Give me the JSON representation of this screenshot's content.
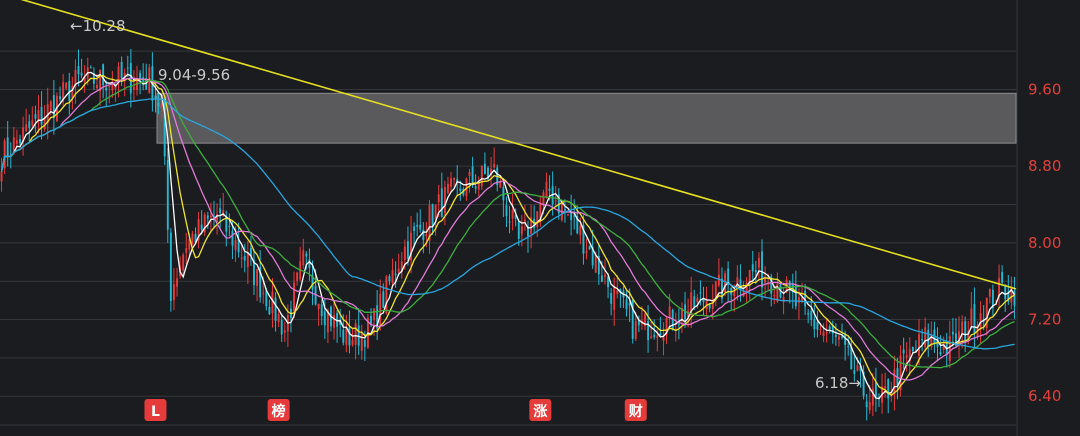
{
  "chart_data": {
    "type": "candlestick",
    "y_range": [
      6.1,
      10.45
    ],
    "y_ticks": [
      "9.60",
      "8.80",
      "8.00",
      "7.20",
      "6.40"
    ],
    "y_tick_values": [
      9.6,
      8.8,
      8.0,
      7.2,
      6.4
    ],
    "grid": true,
    "colors": {
      "background": "#1b1c20",
      "grid": "#34363b",
      "up": "#e63b3b",
      "down": "#27b7d1",
      "trendline": "#e5e021",
      "zone": "#5a5a5d",
      "axis_text": "#e0403a",
      "ma_white": "#ffffff",
      "ma_yellow": "#f2e52c",
      "ma_pink": "#e07ad6",
      "ma_green": "#3fae3f",
      "ma_blue": "#2aa6de"
    },
    "resistance_zone": {
      "low": 9.04,
      "high": 9.56
    },
    "trendline": {
      "start": [
        0,
        10.6
      ],
      "end": [
        330,
        7.52
      ]
    },
    "candles": {
      "count": 330,
      "key_closes": [
        [
          0,
          8.9
        ],
        [
          25,
          9.7
        ],
        [
          48,
          9.7
        ],
        [
          52,
          9.4
        ],
        [
          55,
          7.5
        ],
        [
          60,
          8.0
        ],
        [
          70,
          8.3
        ],
        [
          80,
          7.8
        ],
        [
          92,
          7.1
        ],
        [
          98,
          7.8
        ],
        [
          105,
          7.3
        ],
        [
          112,
          7.0
        ],
        [
          120,
          7.1
        ],
        [
          130,
          7.9
        ],
        [
          145,
          8.5
        ],
        [
          160,
          8.75
        ],
        [
          168,
          8.0
        ],
        [
          178,
          8.55
        ],
        [
          188,
          8.1
        ],
        [
          198,
          7.5
        ],
        [
          206,
          7.1
        ],
        [
          218,
          7.2
        ],
        [
          232,
          7.5
        ],
        [
          245,
          7.7
        ],
        [
          252,
          7.6
        ],
        [
          262,
          7.2
        ],
        [
          272,
          6.95
        ],
        [
          280,
          6.45
        ],
        [
          285,
          6.3
        ],
        [
          293,
          6.75
        ],
        [
          300,
          7.0
        ],
        [
          308,
          6.9
        ],
        [
          318,
          7.3
        ],
        [
          325,
          7.52
        ],
        [
          329,
          7.5
        ]
      ]
    },
    "annotations": {
      "high": "←10.28",
      "zone_label": "9.04-9.56",
      "low": "6.18→"
    },
    "markers": [
      {
        "label": "L",
        "index": 50
      },
      {
        "label": "榜",
        "index": 90
      },
      {
        "label": "涨",
        "index": 175
      },
      {
        "label": "财",
        "index": 206
      }
    ]
  }
}
